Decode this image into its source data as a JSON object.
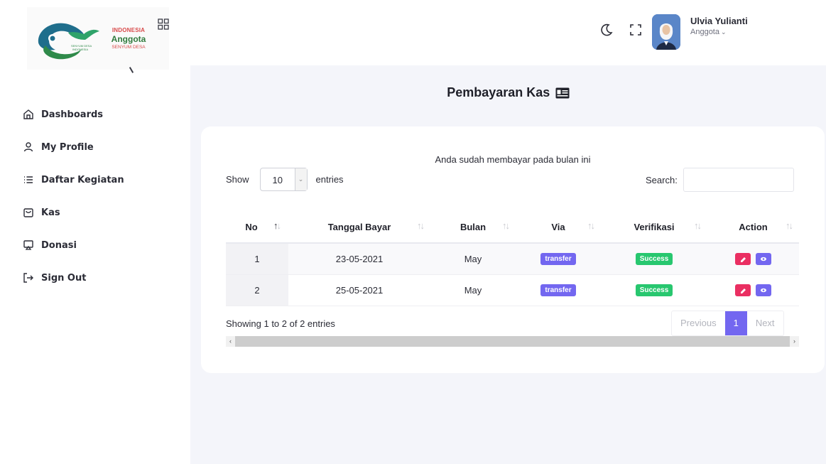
{
  "brand": {
    "line1": "INDONESIA",
    "line2": "Anggota",
    "line3": "SENYUM DESA",
    "logo_text": "SENYUM DESA INDONESIA"
  },
  "sidebar": {
    "items": [
      {
        "label": "Dashboards",
        "icon": "home-icon"
      },
      {
        "label": "My Profile",
        "icon": "user-icon"
      },
      {
        "label": "Daftar Kegiatan",
        "icon": "list-icon"
      },
      {
        "label": "Kas",
        "icon": "wallet-icon"
      },
      {
        "label": "Donasi",
        "icon": "donate-icon"
      },
      {
        "label": "Sign Out",
        "icon": "sign-out-icon"
      }
    ]
  },
  "header": {
    "user_name": "Ulvia Yulianti",
    "user_role": "Anggota"
  },
  "page": {
    "title": "Pembayaran Kas"
  },
  "table_controls": {
    "notice": "Anda sudah membayar pada bulan ini",
    "show_label": "Show",
    "entries_label": "entries",
    "page_length": "10",
    "search_label": "Search:",
    "search_value": ""
  },
  "table": {
    "columns": [
      "No",
      "Tanggal Bayar",
      "Bulan",
      "Via",
      "Verifikasi",
      "Action"
    ],
    "rows": [
      {
        "no": "1",
        "tanggal": "23-05-2021",
        "bulan": "May",
        "via": "transfer",
        "verifikasi": "Success"
      },
      {
        "no": "2",
        "tanggal": "25-05-2021",
        "bulan": "May",
        "via": "transfer",
        "verifikasi": "Success"
      }
    ]
  },
  "pagination": {
    "info": "Showing 1 to 2 of 2 entries",
    "previous": "Previous",
    "current": "1",
    "next": "Next"
  },
  "colors": {
    "primary": "#7367f0",
    "success": "#28c76f",
    "danger": "#ea2f62",
    "background": "#f4f5fa"
  }
}
